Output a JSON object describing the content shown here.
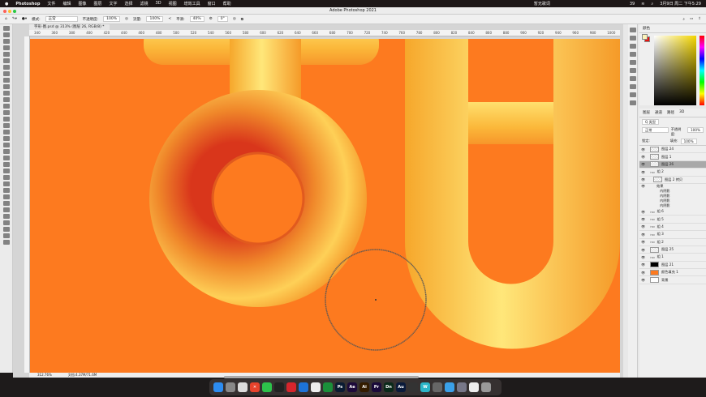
{
  "menubar": {
    "apple": "",
    "app": "Photoshop",
    "items": [
      "文件",
      "编辑",
      "图像",
      "图层",
      "文字",
      "选择",
      "滤镜",
      "3D",
      "视图",
      "增效工具",
      "窗口",
      "帮助"
    ],
    "center": "暂无歌词",
    "battery": "39",
    "clock": "3月9日 周二 下午5:29"
  },
  "window": {
    "title": "Adobe Photoshop 2021"
  },
  "options": {
    "mode_label": "模式:",
    "mode_value": "正常",
    "opacity_label": "不透明度:",
    "opacity_value": "100%",
    "flow_label": "流量:",
    "flow_value": "100%",
    "smooth_label": "平滑:",
    "smooth_value": "40%",
    "angle_value": "0°"
  },
  "document": {
    "tab": "字形-图.psd @ 313% (图层 26, RGB/8) *",
    "zoom": "312.76%",
    "doc_size": "文档:4.37M/71.6M"
  },
  "ruler": {
    "top": [
      "340",
      "360",
      "380",
      "400",
      "420",
      "440",
      "460",
      "480",
      "500",
      "520",
      "540",
      "560",
      "580",
      "600",
      "620",
      "640",
      "660",
      "680",
      "700",
      "720",
      "740",
      "760",
      "780",
      "800",
      "820",
      "840",
      "860",
      "880",
      "900",
      "920",
      "940",
      "960",
      "980",
      "1000"
    ]
  },
  "color_panel": {
    "tabs": [
      "颜色"
    ],
    "foreground": "#fbf3b9",
    "background": "#e8140f"
  },
  "layers_panel": {
    "tabs": [
      "图层",
      "通道",
      "路径",
      "3D"
    ],
    "filter": "Q 类型",
    "blend": "正常",
    "opacity_label": "不透明度:",
    "opacity": "100%",
    "lock_label": "锁定:",
    "fill_label": "填充:",
    "fill": "100%",
    "layers": [
      {
        "name": "图层 24",
        "type": "pixel"
      },
      {
        "name": "图层 1",
        "type": "pixel"
      },
      {
        "name": "图层 26",
        "type": "pixel",
        "selected": true
      },
      {
        "name": "组 2",
        "type": "group"
      },
      {
        "name": "图层 2 拷贝",
        "type": "pixel",
        "indent": 1
      },
      {
        "name": "效果",
        "type": "fx",
        "indent": 2
      },
      {
        "name": "内阴影",
        "type": "fx",
        "indent": 3
      },
      {
        "name": "内阴影",
        "type": "fx",
        "indent": 3
      },
      {
        "name": "内阴影",
        "type": "fx",
        "indent": 3
      },
      {
        "name": "内阴影",
        "type": "fx",
        "indent": 3
      },
      {
        "name": "组 6",
        "type": "group"
      },
      {
        "name": "组 5",
        "type": "group"
      },
      {
        "name": "组 4",
        "type": "group"
      },
      {
        "name": "组 3",
        "type": "group"
      },
      {
        "name": "组 2",
        "type": "group"
      },
      {
        "name": "图层 25",
        "type": "pixel"
      },
      {
        "name": "组 1",
        "type": "group"
      },
      {
        "name": "图层 21",
        "type": "mask"
      },
      {
        "name": "颜色填充 1",
        "type": "fill"
      },
      {
        "name": "背景",
        "type": "bg"
      }
    ]
  },
  "canvas": {
    "background": "#fd7a1f"
  },
  "dock": [
    {
      "label": "",
      "color": "#2d8cf0"
    },
    {
      "label": "",
      "color": "#888"
    },
    {
      "label": "",
      "color": "#ddd"
    },
    {
      "label": "✕",
      "color": "#e8432c"
    },
    {
      "label": "",
      "color": "#2dc24b"
    },
    {
      "label": "",
      "color": "#222"
    },
    {
      "label": "",
      "color": "#d7252c"
    },
    {
      "label": "",
      "color": "#1d73d8"
    },
    {
      "label": "",
      "color": "#eee"
    },
    {
      "label": "",
      "color": "#1b8f3a"
    },
    {
      "label": "Ps",
      "color": "#0a1b32"
    },
    {
      "label": "Ae",
      "color": "#1c0a3a"
    },
    {
      "label": "Ai",
      "color": "#331c00"
    },
    {
      "label": "Pr",
      "color": "#1a0a3a"
    },
    {
      "label": "Dn",
      "color": "#0a2a1a"
    },
    {
      "label": "Au",
      "color": "#0a1a3a"
    },
    {
      "label": "",
      "color": "#333"
    },
    {
      "label": "W",
      "color": "#2bb6c9"
    },
    {
      "label": "",
      "color": "#666"
    },
    {
      "label": "",
      "color": "#3aa0e8"
    },
    {
      "label": "",
      "color": "#778"
    },
    {
      "label": "",
      "color": "#eee"
    },
    {
      "label": "",
      "color": "#999"
    }
  ]
}
